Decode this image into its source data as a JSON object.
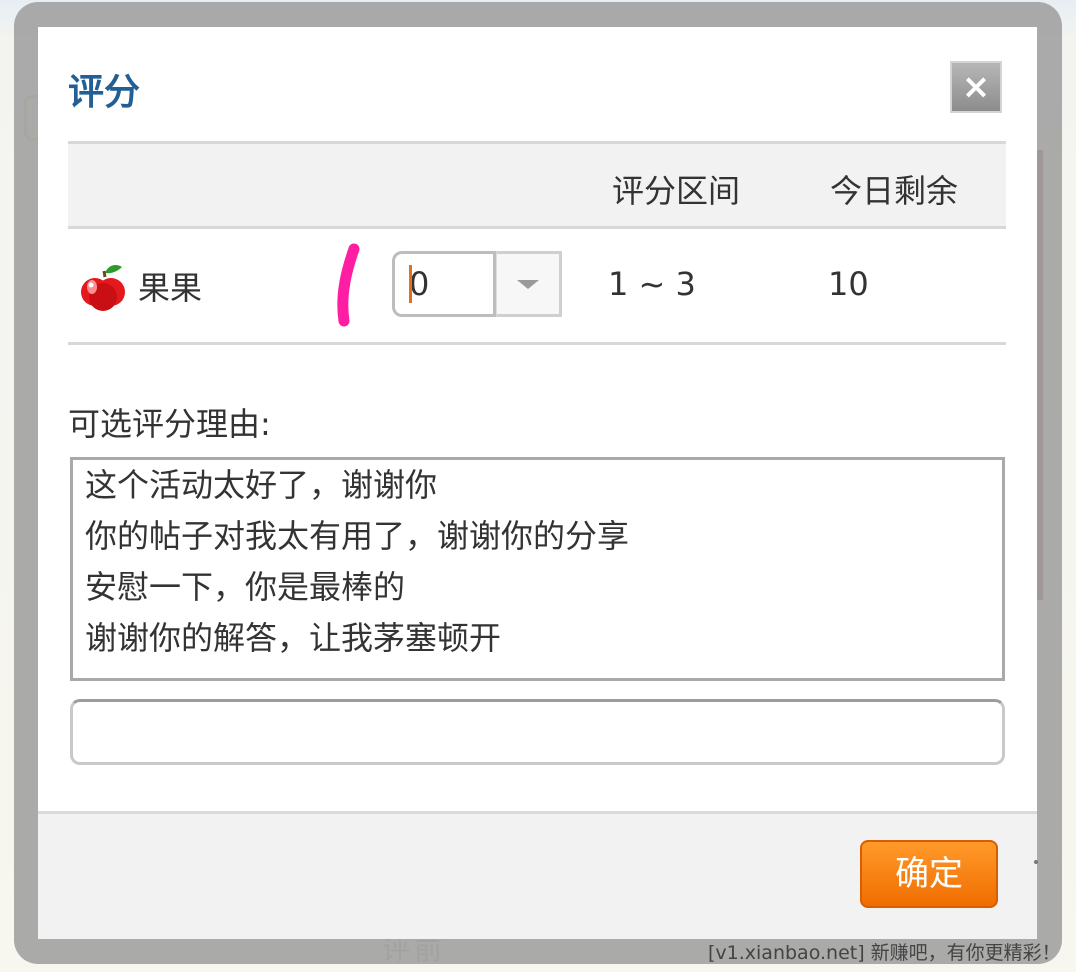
{
  "dialog": {
    "title": "评分",
    "close_label": "×"
  },
  "rating_table": {
    "headers": {
      "item": "",
      "range": "评分区间",
      "remaining": "今日剩余"
    },
    "rows": [
      {
        "icon": "apple-icon",
        "name": "果果",
        "score_value": "0",
        "range": "1 ~ 3",
        "remaining": "10"
      }
    ]
  },
  "reasons": {
    "label": "可选评分理由:",
    "options": [
      "这个活动太好了，谢谢你",
      "你的帖子对我太有用了，谢谢你的分享",
      "安慰一下，你是最棒的",
      "谢谢你的解答，让我茅塞顿开"
    ],
    "custom_reason_value": ""
  },
  "footer": {
    "confirm_label": "确定"
  },
  "background": {
    "under_text": "评前",
    "watermark": "[v1.xianbao.net] 新赚吧，有你更精彩！"
  },
  "colors": {
    "title": "#215f95",
    "confirm": "#f57c0f",
    "annotation_mark": "#ff1ea3"
  }
}
